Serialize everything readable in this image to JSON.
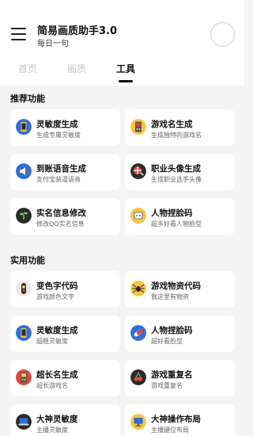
{
  "header": {
    "title": "简易画质助手3.0",
    "subtitle": "每日一句"
  },
  "tabs": [
    {
      "label": "首页",
      "active": false
    },
    {
      "label": "画质",
      "active": false
    },
    {
      "label": "工具",
      "active": true
    }
  ],
  "sections": [
    {
      "title": "推荐功能",
      "items": [
        {
          "title": "灵敏度生成",
          "desc": "生成专属灵敏度",
          "icon": "phone-icon"
        },
        {
          "title": "游戏名生成",
          "desc": "生成独特的游戏名",
          "icon": "gameboy-icon"
        },
        {
          "title": "到账语音生成",
          "desc": "支付宝装逼语音",
          "icon": "speaker-icon"
        },
        {
          "title": "职业头像生成",
          "desc": "生成职业选手头像",
          "icon": "player-avatar-icon"
        },
        {
          "title": "实名信息修改",
          "desc": "修改QQ实名信息",
          "icon": "id-sprout-icon"
        },
        {
          "title": "人物捏脸码",
          "desc": "超多好看人物脸型",
          "icon": "robot-face-icon"
        }
      ]
    },
    {
      "title": "实用功能",
      "items": [
        {
          "title": "变色字代码",
          "desc": "游戏颜色文字",
          "icon": "color-pen-icon"
        },
        {
          "title": "游戏物资代码",
          "desc": "我这里有物资",
          "icon": "spider-icon"
        },
        {
          "title": "灵敏度生成",
          "desc": "超稳灵敏度",
          "icon": "phone-icon"
        },
        {
          "title": "人物捏脸码",
          "desc": "超好看脸型",
          "icon": "capsule-icon"
        },
        {
          "title": "超长名生成",
          "desc": "超长游戏名",
          "icon": "gameboy-icon"
        },
        {
          "title": "游戏重复名",
          "desc": "游戏重复名",
          "icon": "cherries-icon"
        },
        {
          "title": "大神灵敏度",
          "desc": "主播灵敏度",
          "icon": "laptop-icon"
        },
        {
          "title": "大神操作布局",
          "desc": "主播键位布局",
          "icon": "monitor-icon"
        }
      ]
    }
  ],
  "colors": {
    "background": "#f4f4f4",
    "card": "#ffffff",
    "icon_yellow": "#f6c445",
    "icon_blue": "#2f6fd6",
    "icon_dark": "#2b2b2b",
    "icon_red": "#e2463b",
    "tab_inactive": "#c4c4c4"
  }
}
